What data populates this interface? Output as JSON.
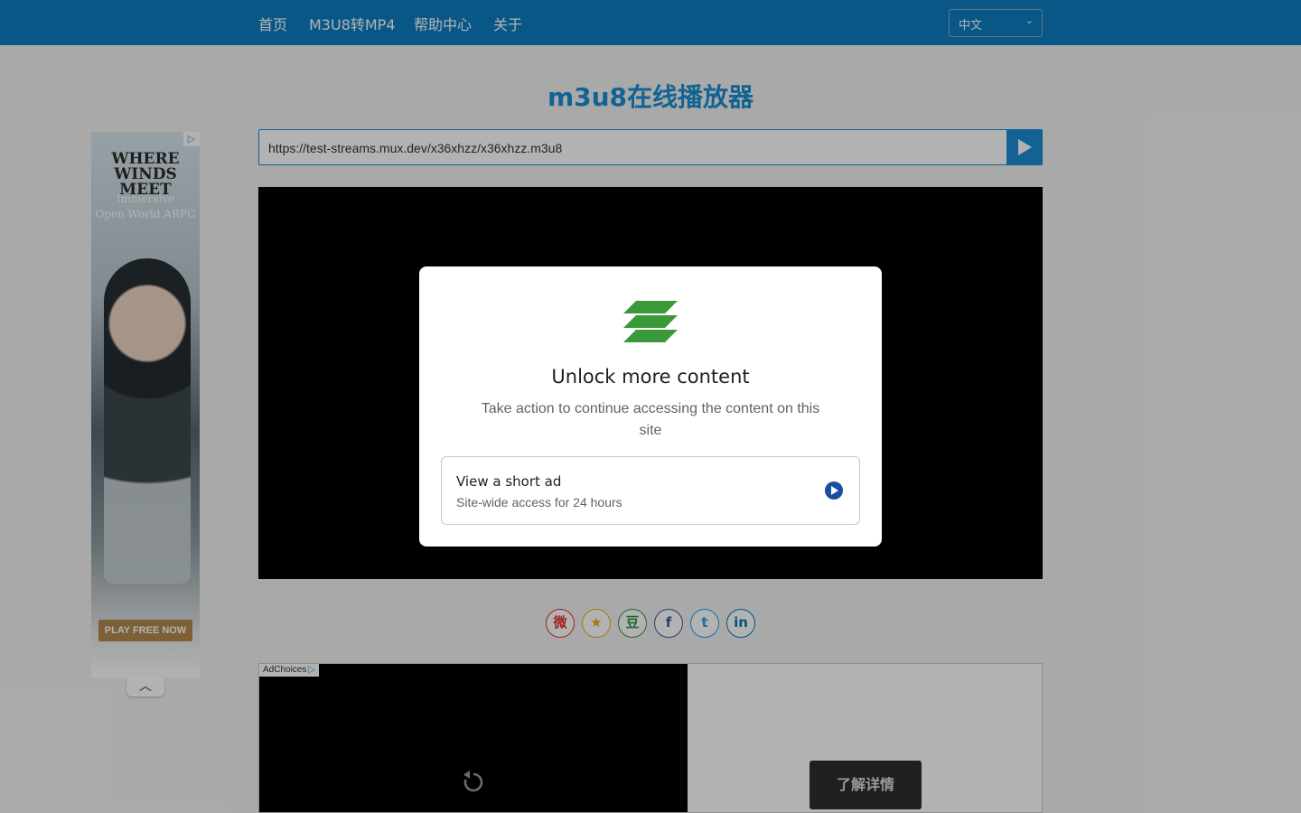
{
  "nav": {
    "items": [
      {
        "label": "首页"
      },
      {
        "label": "M3U8转MP4"
      },
      {
        "label": "帮助中心"
      },
      {
        "label": "关于"
      }
    ],
    "language": "中文"
  },
  "page_title": "m3u8在线播放器",
  "url_bar": {
    "value": "https://test-streams.mux.dev/x36xhzz/x36xhzz.m3u8"
  },
  "side_ad": {
    "title_line1": "WHERE",
    "title_line2": "WINDS MEET",
    "subtitle_line1": "Immersive",
    "subtitle_line2": "Open World ARPG",
    "cta": "PLAY FREE NOW"
  },
  "share": {
    "icons": [
      "weibo-icon",
      "qzone-icon",
      "douban-icon",
      "facebook-icon",
      "twitter-icon",
      "linkedin-icon"
    ]
  },
  "bottom_ad": {
    "adchoices": "AdChoices",
    "learn_more": "了解详情"
  },
  "modal": {
    "title": "Unlock more content",
    "description": "Take action to continue accessing the content on this site",
    "option": {
      "title": "View a short ad",
      "subtitle": "Site-wide access for 24 hours"
    }
  },
  "colors": {
    "nav_bg": "#0e7dc1",
    "accent": "#1a8ed3",
    "logo_green": "#3a9a3a",
    "option_arrow": "#1a4fa0"
  }
}
